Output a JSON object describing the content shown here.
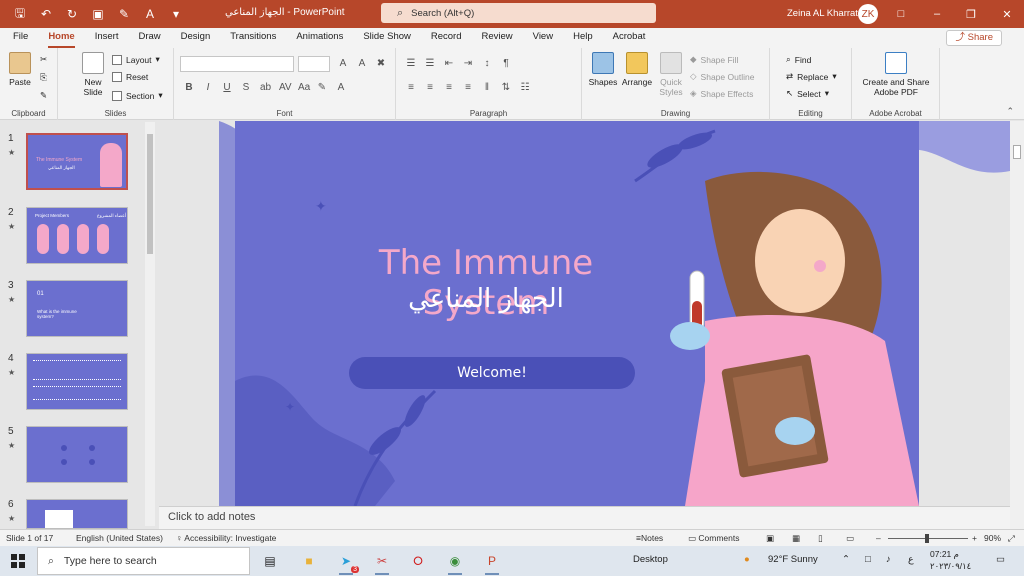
{
  "titlebar": {
    "doc_title": "الجهاز المناعي  -  PowerPoint",
    "search_placeholder": "Search (Alt+Q)",
    "user_name": "Zeina AL Kharrat",
    "avatar_initials": "ZK"
  },
  "menu": {
    "tabs": [
      "File",
      "Home",
      "Insert",
      "Draw",
      "Design",
      "Transitions",
      "Animations",
      "Slide Show",
      "Record",
      "Review",
      "View",
      "Help",
      "Acrobat"
    ],
    "active_tab": "Home",
    "share_label": "Share"
  },
  "ribbon": {
    "clipboard": {
      "label": "Clipboard",
      "paste": "Paste"
    },
    "slides": {
      "label": "Slides",
      "new_slide": "New Slide",
      "layout": "Layout",
      "reset": "Reset",
      "section": "Section"
    },
    "font": {
      "label": "Font"
    },
    "paragraph": {
      "label": "Paragraph"
    },
    "drawing": {
      "label": "Drawing",
      "shapes": "Shapes",
      "arrange": "Arrange",
      "quick_styles": "Quick Styles",
      "shape_fill": "Shape Fill",
      "shape_outline": "Shape Outline",
      "shape_effects": "Shape Effects"
    },
    "editing": {
      "label": "Editing",
      "find": "Find",
      "replace": "Replace",
      "select": "Select"
    },
    "acrobat": {
      "label": "Adobe Acrobat",
      "create_share": "Create and Share Adobe PDF"
    }
  },
  "thumbnails": [
    {
      "num": "1",
      "title": "The Immune System",
      "sub": "الجهاز المناعي"
    },
    {
      "num": "2",
      "title": "Project Members",
      "sub": "أعضاء المشروع"
    },
    {
      "num": "3",
      "title": "What is the immune system?",
      "sub": "01"
    },
    {
      "num": "4",
      "title": "",
      "sub": ""
    },
    {
      "num": "5",
      "title": "",
      "sub": ""
    },
    {
      "num": "6",
      "title": "",
      "sub": ""
    }
  ],
  "slide": {
    "title": "The Immune System",
    "subtitle": "الجهاز المناعي",
    "button": "Welcome!"
  },
  "notes_placeholder": "Click to add notes",
  "status": {
    "slide_count": "Slide 1 of 17",
    "language": "English (United States)",
    "accessibility": "Accessibility: Investigate",
    "notes": "Notes",
    "comments": "Comments",
    "zoom": "90%"
  },
  "taskbar": {
    "search_placeholder": "Type here to search",
    "desktop": "Desktop",
    "weather": "92°F  Sunny",
    "time": "07:21 م",
    "date": "٢٠٢٣/٠٩/١٤",
    "badge": "3"
  },
  "colors": {
    "accent": "#b7472a",
    "slide_bg": "#6b6fcf",
    "slide_title": "#f4a8c9"
  }
}
